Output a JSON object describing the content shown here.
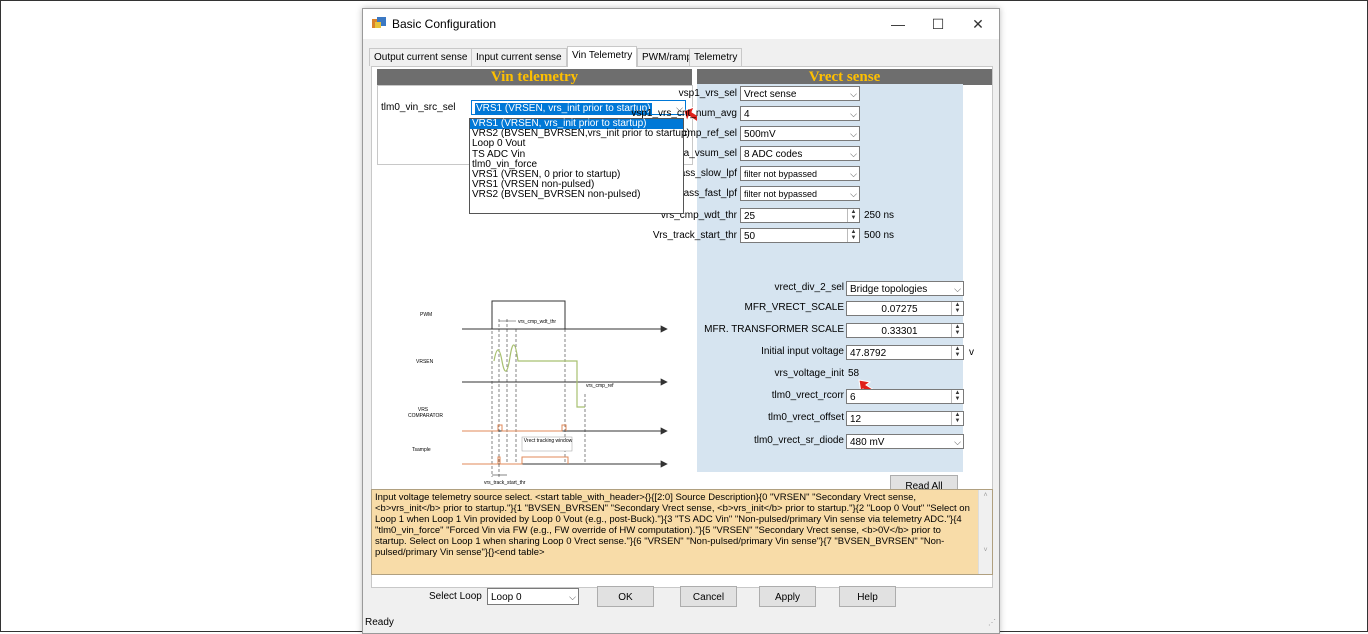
{
  "window": {
    "title": "Basic Configuration",
    "minimize": "—",
    "maximize": "☐",
    "close": "✕"
  },
  "tabs": [
    "Output current sense",
    "Input current sense",
    "Vin Telemetry",
    "PWM/ramp",
    "Telemetry"
  ],
  "vin_telemetry": {
    "header": "Vin telemetry",
    "src_sel_label": "tlm0_vin_src_sel",
    "src_sel_value": "VRS1 (VRSEN, vrs_init prior to startup)",
    "options": [
      "VRS1 (VRSEN, vrs_init prior to startup)",
      "VRS2 (BVSEN_BVRSEN,vrs_init prior to startup)",
      "Loop 0 Vout",
      "TS ADC Vin",
      "tlm0_vin_force",
      "VRS1 (VRSEN, 0 prior to startup)",
      "VRS1 (VRSEN non-pulsed)",
      "VRS2 (BVSEN_BVRSEN non-pulsed)"
    ]
  },
  "diagram": {
    "pwm": "PWM",
    "vrsen": "VRSEN",
    "vrs_comparator": "VRS COMPARATOR",
    "tsample": "Tsample",
    "cmp_wdt": "vrs_cmp_wdt_thr",
    "cmp_ref": "vrs_cmp_ref",
    "vrect_tracking": "Vrect tracking window",
    "track_start": "vrs_track_start_thr"
  },
  "vrect_sense": {
    "header": "Vrect sense",
    "fields": [
      {
        "label": "vsp1_vrs_sel",
        "value": "Vrect sense",
        "kind": "combo"
      },
      {
        "label": "vsp1_vrs_cnt_num_avg",
        "value": "4",
        "kind": "combo"
      },
      {
        "label": "vrs_cmp_ref_sel",
        "value": "500mV",
        "kind": "combo"
      },
      {
        "label": "vrs_delta_vsum_sel",
        "value": "8 ADC codes",
        "kind": "combo"
      },
      {
        "label": "Vrs_bypass_slow_lpf",
        "value": "filter not bypassed",
        "kind": "combo"
      },
      {
        "label": "vrs_bypass_fast_lpf",
        "value": "filter not bypassed",
        "kind": "combo"
      },
      {
        "label": "vrs_cmp_wdt_thr",
        "value": "25",
        "kind": "spin",
        "unit": "250 ns"
      },
      {
        "label": "Vrs_track_start_thr",
        "value": "50",
        "kind": "spin",
        "unit": "500 ns"
      }
    ],
    "fields2": [
      {
        "label": "vrect_div_2_sel",
        "value": "Bridge topologies",
        "kind": "combo"
      },
      {
        "label": "MFR_VRECT_SCALE",
        "value": "0.07275",
        "kind": "spin"
      },
      {
        "label": "MFR. TRANSFORMER SCALE",
        "value": "0.33301",
        "kind": "spin"
      },
      {
        "label": "Initial input voltage",
        "value": "47.8792",
        "kind": "spin",
        "unit": "v"
      },
      {
        "label": "vrs_voltage_init",
        "value": "58",
        "kind": "text"
      },
      {
        "label": "tlm0_vrect_rcorr",
        "value": "6",
        "kind": "spin"
      },
      {
        "label": "tlm0_vrect_offset",
        "value": "12",
        "kind": "spin"
      },
      {
        "label": "tlm0_vrect_sr_diode",
        "value": "480 mV",
        "kind": "combo"
      }
    ]
  },
  "read_all": "Read All",
  "description": "Input voltage telemetry source select. <start table_with_header>{}{[2:0] Source Description}{0 \"VRSEN\" \"Secondary Vrect sense, <b>vrs_init</b> prior to startup.\"}{1 \"BVSEN_BVRSEN\" \"Secondary Vrect sense, <b>vrs_init</b> prior to startup.\"}{2 \"Loop 0 Vout\" \"Select on Loop 1 when Loop 1 Vin provided by Loop 0 Vout (e.g., post-Buck).\"}{3 \"TS ADC Vin\" \"Non-pulsed/primary Vin sense via telemetry ADC.\"}{4 \"tlm0_vin_force\" \"Forced Vin via FW (e.g., FW override of HW computation).\"}{5 \"VRSEN\" \"Secondary Vrect sense, <b>0V</b> prior to startup. Select on Loop 1 when sharing Loop 0 Vrect sense.\"}{6 \"VRSEN\" \"Non-pulsed/primary Vin sense\"}{7 \"BVSEN_BVRSEN\" \"Non-pulsed/primary Vin sense\"}{}<end table>",
  "bottom": {
    "select_loop_label": "Select Loop",
    "select_loop_value": "Loop 0",
    "ok": "OK",
    "cancel": "Cancel",
    "apply": "Apply",
    "help": "Help"
  },
  "status": "Ready",
  "colors": {
    "header_bg": "#6e6e6e",
    "header_text": "#ffc000",
    "vrect_panel": "#d6e4f0",
    "desc_bg": "#f8dca8",
    "annotation_arrow": "#e0201a"
  }
}
